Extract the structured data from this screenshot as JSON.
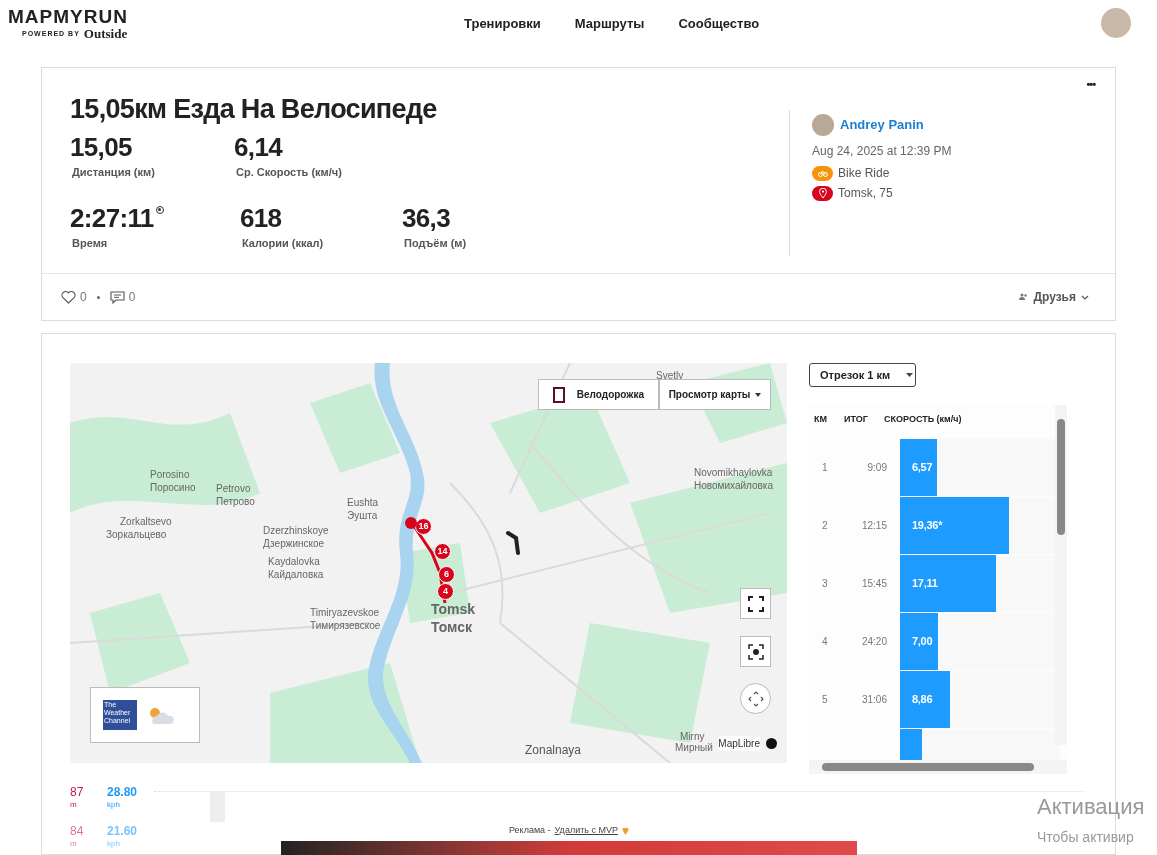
{
  "header": {
    "logo": "MAPMYRUN",
    "logo_sub": "POWERED BY",
    "logo_brand": "Outside",
    "nav": [
      {
        "label": "Тренировки"
      },
      {
        "label": "Маршруты"
      },
      {
        "label": "Сообщество"
      }
    ]
  },
  "workout": {
    "title": "15,05км Езда На Велосипеде",
    "menu": "•••",
    "stats": [
      {
        "value": "15,05",
        "label": "Дистанция (км)"
      },
      {
        "value": "6,14",
        "label": "Ср. Скорость (км/ч)"
      }
    ],
    "stats2": [
      {
        "value": "2:27:11",
        "label": "Время",
        "badge": true
      },
      {
        "value": "618",
        "label": "Калории (ккал)"
      },
      {
        "value": "36,3",
        "label": "Подъём (м)"
      }
    ],
    "author": "Andrey Panin",
    "date": "Aug 24, 2025 at 12:39 PM",
    "activity": "Bike Ride",
    "location": "Tomsk, 75",
    "likes": "0",
    "comments": "0",
    "privacy": "Друзья"
  },
  "map": {
    "bike_lane": {
      "label": "Велодорожка",
      "checked": false
    },
    "view_button": "Просмотр карты",
    "labels": [
      {
        "text": "Svetly"
      },
      {
        "text": "Porosino"
      },
      {
        "text": "Поросино"
      },
      {
        "text": "Petrovo"
      },
      {
        "text": "Петрово"
      },
      {
        "text": "Zorkaltsevo"
      },
      {
        "text": "Зоркальцево"
      },
      {
        "text": "Eushta"
      },
      {
        "text": "Эушта"
      },
      {
        "text": "Dzerzhinskoye"
      },
      {
        "text": "Дзержинское"
      },
      {
        "text": "Kaydalovka"
      },
      {
        "text": "Кайдаловка"
      },
      {
        "text": "Timiryazevskoe"
      },
      {
        "text": "Тимирязевское"
      },
      {
        "text": "Tomsk"
      },
      {
        "text": "Томск"
      },
      {
        "text": "Novomikhaylovka"
      },
      {
        "text": "Новомихайловка"
      },
      {
        "text": "Mirny"
      },
      {
        "text": "Мирный"
      },
      {
        "text": "Zonalnaya"
      }
    ],
    "markers": [
      "16",
      "14",
      "6",
      "4"
    ],
    "weather_logo": "The Weather Channel",
    "attribution": "MapLibre"
  },
  "splits": {
    "segment": "Отрезок 1 км",
    "columns": [
      "КМ",
      "ИТОГ",
      "СКОРОСТЬ (км/ч)"
    ],
    "rows": [
      {
        "km": "1",
        "time": "9:09",
        "speed": "6,57",
        "level": 0.23
      },
      {
        "km": "2",
        "time": "12:15",
        "speed": "19,36*",
        "level": 0.68
      },
      {
        "km": "3",
        "time": "15:45",
        "speed": "17,11",
        "level": 0.6
      },
      {
        "km": "4",
        "time": "24:20",
        "speed": "7,00",
        "level": 0.24
      },
      {
        "km": "5",
        "time": "31:06",
        "speed": "8,86",
        "level": 0.31
      },
      {
        "level": 0.14
      }
    ]
  },
  "elevation": [
    {
      "value": "87",
      "unit": "m",
      "speed": "28.80",
      "speed_unit": "kph",
      "faded": false
    },
    {
      "value": "84",
      "unit": "m",
      "speed": "21.60",
      "speed_unit": "kph",
      "faded": true
    }
  ],
  "ad": {
    "label": "Реклама - ",
    "link": "Удалить с MVP"
  },
  "os_notice": [
    "Активация",
    "Чтобы активир"
  ]
}
